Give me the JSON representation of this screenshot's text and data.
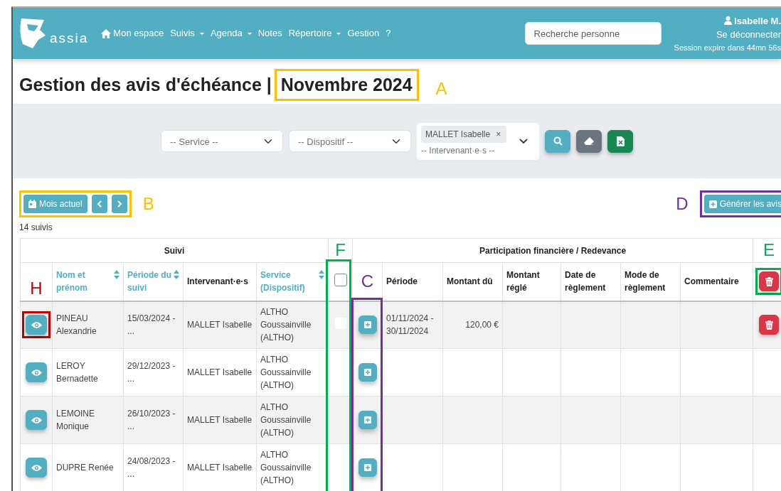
{
  "navbar": {
    "brand": "assia",
    "menu": [
      {
        "label": "Mon espace",
        "kind": "home"
      },
      {
        "label": "Suivis",
        "kind": "dropdown"
      },
      {
        "label": "Agenda",
        "kind": "dropdown"
      },
      {
        "label": "Notes",
        "kind": "link"
      },
      {
        "label": "Répertoire",
        "kind": "dropdown"
      },
      {
        "label": "Gestion",
        "kind": "link"
      },
      {
        "label": "?",
        "kind": "link"
      }
    ],
    "search": {
      "placeholder": "Recherche personne"
    },
    "user": {
      "name": "Isabelle M.",
      "logout": "Se déconnecter",
      "session": "Session expire dans 44mn 56s"
    }
  },
  "page_title": {
    "text": "Gestion des avis d'échéance |",
    "month": "Novembre 2024"
  },
  "filters": {
    "selects": [
      {
        "placeholder": "-- Service --"
      },
      {
        "placeholder": "-- Dispositif --"
      }
    ],
    "intervenants": {
      "tags": [
        {
          "label": "MALLET Isabelle",
          "remove": "×"
        }
      ],
      "placeholder": "-- Intervenant·e·s --"
    },
    "buttons": [
      {
        "kind": "search"
      },
      {
        "kind": "clear"
      },
      {
        "kind": "export"
      }
    ]
  },
  "toolbar": {
    "current_month": "Mois actuel",
    "generate": "Générer les avis",
    "count": "14 suivis"
  },
  "table": {
    "groups": [
      {
        "label": "Suivi"
      },
      {
        "label": "Participation financière / Redevance"
      }
    ],
    "follow_columns": [
      {
        "label": "Nom et prénom",
        "sortable": true
      },
      {
        "label": "Période du suivi",
        "sortable": true
      },
      {
        "label": "Intervenant·e·s",
        "sortable": false
      },
      {
        "label": "Service (Dispositif)",
        "sortable": true
      }
    ],
    "select_all": {
      "checked": false
    },
    "fee_columns": [
      {
        "label": "Période"
      },
      {
        "label": "Montant dû"
      },
      {
        "label": "Montant réglé"
      },
      {
        "label": "Date de règlement"
      },
      {
        "label": "Mode de règlement"
      },
      {
        "label": "Commentaire"
      }
    ],
    "rows": [
      {
        "name": "PINEAU Alexandrie",
        "period": "15/03/2024 - ...",
        "intervenant": "MALLET Isabelle",
        "service": "ALTHO Goussainville (ALTHO)",
        "selected": false,
        "avis": {
          "period": "01/11/2024 - 30/11/2024",
          "amount_due": "120,00 €"
        }
      },
      {
        "name": "LEROY Bernadette",
        "period": "29/12/2023 - ...",
        "intervenant": "MALLET Isabelle",
        "service": "ALTHO Goussainville (ALTHO)"
      },
      {
        "name": "LEMOINE Monique",
        "period": "26/10/2023 - ...",
        "intervenant": "MALLET Isabelle",
        "service": "ALTHO Goussainville (ALTHO)"
      },
      {
        "name": "DUPRE Renée",
        "period": "24/08/2023 - ...",
        "intervenant": "MALLET Isabelle",
        "service": "ALTHO Goussainville (ALTHO)"
      }
    ]
  },
  "annotations": [
    {
      "letter": "A",
      "kind": "month",
      "color": "#ffc000"
    },
    {
      "letter": "B",
      "kind": "navigation",
      "color": "#ffc000"
    },
    {
      "letter": "D",
      "kind": "generate",
      "color": "#7030a0"
    },
    {
      "letter": "F",
      "kind": "selection",
      "color": "#00b050"
    },
    {
      "letter": "C",
      "kind": "addition",
      "color": "#7030a0"
    },
    {
      "letter": "E",
      "kind": "deletion",
      "color": "#00b050"
    },
    {
      "letter": "H",
      "kind": "view",
      "color": "#c00000"
    }
  ]
}
